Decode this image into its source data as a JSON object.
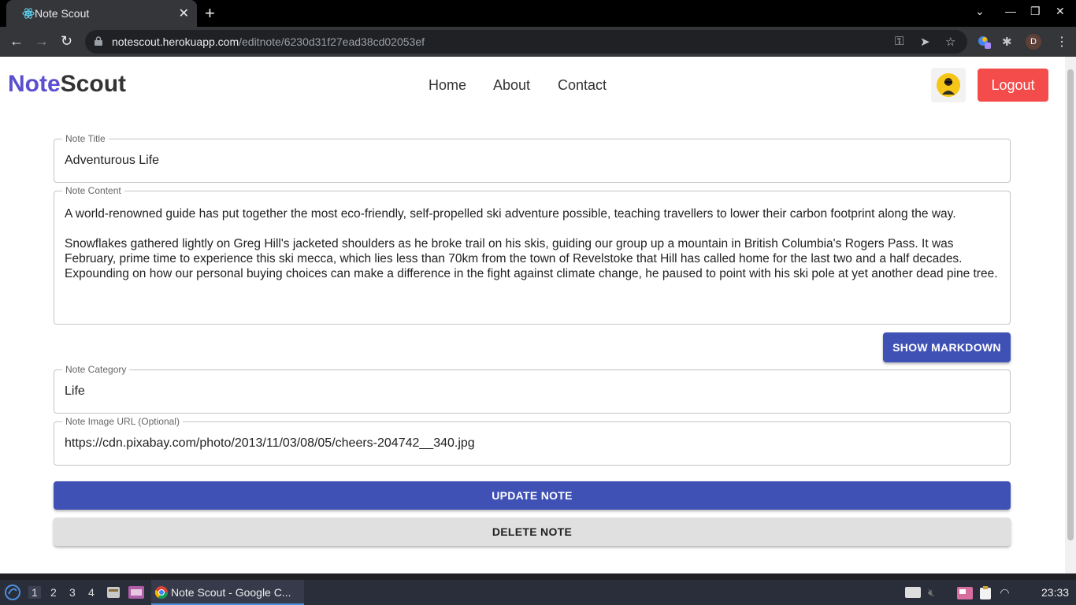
{
  "browser": {
    "tab_title": "Note Scout",
    "url_host": "notescout.herokuapp.com",
    "url_path": "/editnote/6230d31f27ead38cd02053ef",
    "profile_initial": "D"
  },
  "app": {
    "brand_accent": "Note",
    "brand_rest": "Scout",
    "nav": [
      "Home",
      "About",
      "Contact"
    ],
    "logout_label": "Logout"
  },
  "form": {
    "title_label": "Note Title",
    "title_value": "Adventurous Life",
    "content_label": "Note Content",
    "content_paragraphs": [
      "A world-renowned guide has put together the most eco-friendly, self-propelled ski adventure possible, teaching travellers to lower their carbon footprint along the way.",
      "Snowflakes gathered lightly on Greg Hill's jacketed shoulders as he broke trail on his skis, guiding our group up a mountain in British Columbia's Rogers Pass. It was February, prime time to experience this ski mecca, which lies less than 70km from the town of Revelstoke that Hill has called home for the last two and a half decades. Expounding on how our personal buying choices can make a difference in the fight against climate change, he paused to point with his ski pole at yet another dead pine tree."
    ],
    "markdown_button": "SHOW MARKDOWN",
    "category_label": "Note Category",
    "category_value": "Life",
    "image_label": "Note Image URL (Optional)",
    "image_value": "https://cdn.pixabay.com/photo/2013/11/03/08/05/cheers-204742__340.jpg",
    "update_button": "UPDATE NOTE",
    "delete_button": "DELETE NOTE"
  },
  "taskbar": {
    "workspaces": [
      "1",
      "2",
      "3",
      "4"
    ],
    "task_label": "Note Scout - Google C...",
    "clock": "23:33"
  },
  "colors": {
    "brand_accent": "#5b4fcf",
    "logout_bg": "#f44b4b",
    "primary_button": "#3f51b5",
    "delete_button": "#e0e0e0"
  }
}
